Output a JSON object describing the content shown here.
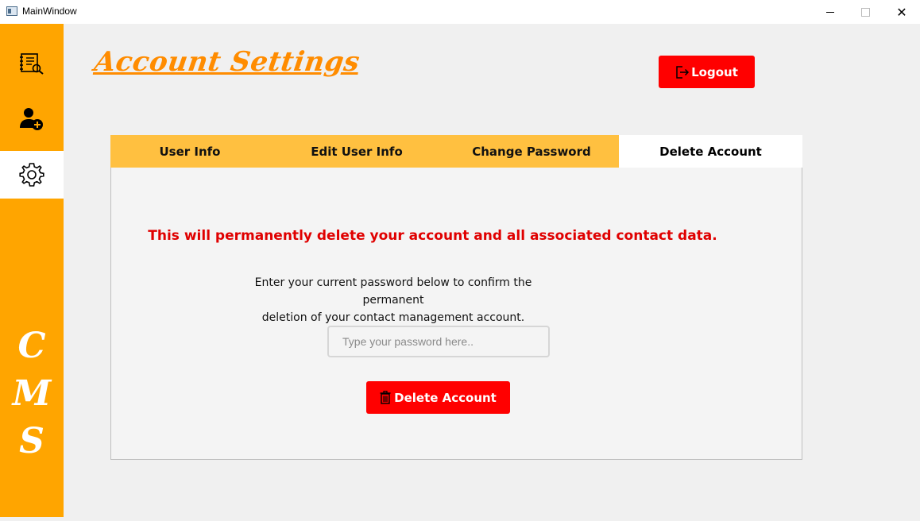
{
  "window": {
    "title": "MainWindow",
    "controls": {
      "minimize": "minimize",
      "maximize": "maximize",
      "close": "✕"
    }
  },
  "sidebar": {
    "items": [
      {
        "name": "contacts",
        "icon": "address-book-icon",
        "active": false
      },
      {
        "name": "add-contact",
        "icon": "add-user-icon",
        "active": false
      },
      {
        "name": "settings",
        "icon": "gear-icon",
        "active": true
      }
    ],
    "brand_letters": [
      "C",
      "M",
      "S"
    ]
  },
  "header": {
    "title": "Account Settings",
    "logout_label": "Logout"
  },
  "tabs": [
    {
      "label": "User Info",
      "active": false
    },
    {
      "label": "Edit User Info",
      "active": false
    },
    {
      "label": "Change Password",
      "active": false
    },
    {
      "label": "Delete Account",
      "active": true
    }
  ],
  "delete_panel": {
    "warning": "This will permanently delete your account and all associated contact data.",
    "instructions_line1": "Enter your current password below to confirm the permanent",
    "instructions_line2": "deletion of your contact management account.",
    "password_placeholder": "Type your password here..",
    "password_value": "",
    "delete_button_label": "Delete Account"
  },
  "colors": {
    "sidebar": "#ffa500",
    "tab_bar": "#ffc040",
    "title": "#ff8c00",
    "danger": "#ff0000",
    "warning_text": "#e00000"
  }
}
